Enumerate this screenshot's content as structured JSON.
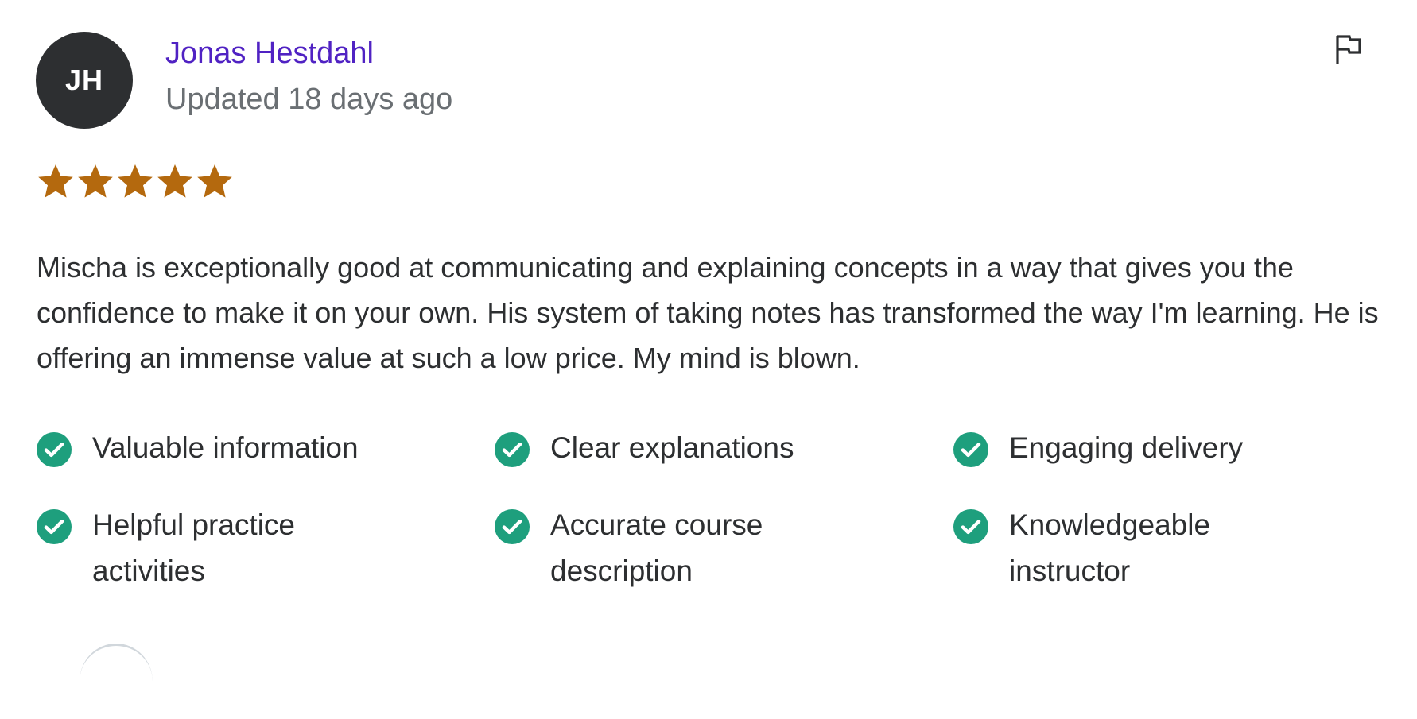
{
  "review": {
    "avatar_initials": "JH",
    "reviewer_name": "Jonas Hestdahl",
    "updated_text": "Updated 18 days ago",
    "flag_icon": "flag-icon",
    "rating": 5,
    "rating_max": 5,
    "star_color": "#b4690e",
    "comment": "Mischa is exceptionally good at communicating and explaining concepts in a way that gives you the confidence to make it on your own. His system of taking notes has transformed the way I'm learning. He is offering an immense value at such a low price. My mind is blown.",
    "tags": [
      {
        "label": "Valuable information",
        "icon": "check-circle-icon"
      },
      {
        "label": "Clear explanations",
        "icon": "check-circle-icon"
      },
      {
        "label": "Engaging delivery",
        "icon": "check-circle-icon"
      },
      {
        "label": "Helpful practice activities",
        "icon": "check-circle-icon"
      },
      {
        "label": "Accurate course description",
        "icon": "check-circle-icon"
      },
      {
        "label": "Knowledgeable instructor",
        "icon": "check-circle-icon"
      }
    ],
    "check_color": "#1e9f7d",
    "name_color": "#5022c3"
  }
}
